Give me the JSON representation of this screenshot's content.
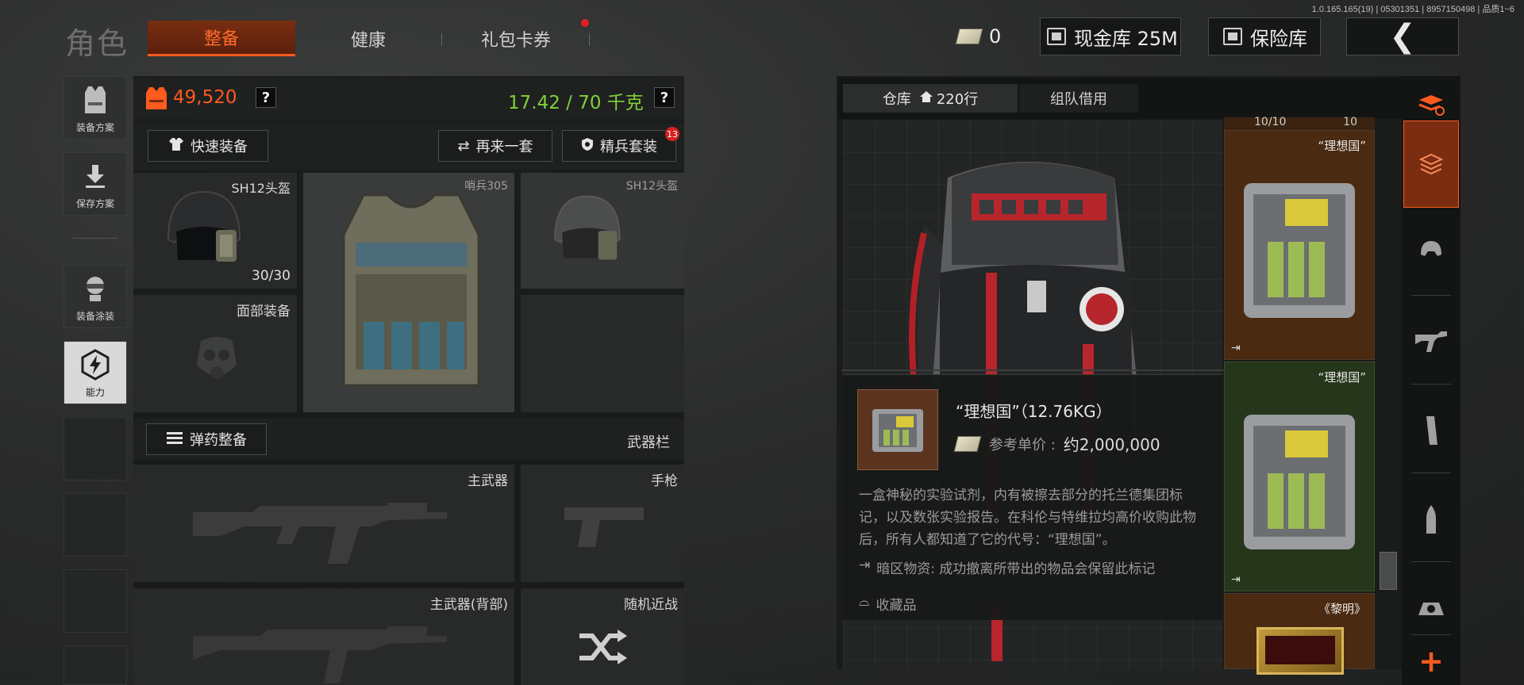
{
  "version": "1.0.165.165(19) | 05301351 | 8957150498 | 品质1~6",
  "nav": {
    "role": "角色",
    "tabs": [
      "整备",
      "健康",
      "礼包卡券"
    ],
    "cash_count": "0",
    "cash_vault": "现金库 25M",
    "insurance": "保险库",
    "back": "❮"
  },
  "left_rail": [
    {
      "label": "装备方案",
      "icon": "vest-icon"
    },
    {
      "label": "保存方案",
      "icon": "download-icon"
    },
    {
      "label": "装备涂装",
      "icon": "paint-icon"
    },
    {
      "label": "能力",
      "icon": "ability-icon"
    }
  ],
  "loadout": {
    "armor_value": "49,520",
    "weight": "17.42 / 70 千克",
    "help": "?",
    "quick_equip": "快速装备",
    "again": "再来一套",
    "elite": "精兵套装",
    "elite_badge": "13",
    "helmet_name": "SH12头盔",
    "helmet_durability": "30/30",
    "vest_name": "哨兵305",
    "helmet2_name": "SH12头盔",
    "face_gear": "面部装备",
    "ammo_equip": "弹药整备",
    "weapon_bar": "武器栏",
    "primary": "主武器",
    "pistol": "手枪",
    "primary_back": "主武器(背部)",
    "melee": "随机近战"
  },
  "warehouse": {
    "tab_main": "仓库",
    "rows": "220行",
    "tab_team": "组队借用",
    "top_left_count": "10/10",
    "top_right_count": "10"
  },
  "side_items": [
    {
      "title": "“理想国”",
      "color": "#4b2a12"
    },
    {
      "title": "“理想国”",
      "color": "#25361b"
    },
    {
      "title": "《黎明》",
      "color": "#4b2a12"
    }
  ],
  "tooltip": {
    "name": "“理想国”（12.76KG）",
    "price_label": "参考单价 :",
    "price_value": "约2,000,000",
    "description": "一盒神秘的实验试剂，内有被擦去部分的托兰德集团标记，以及数张实验报告。在科伦与特维拉均高价收购此物后，所有人都知道了它的代号：“理想国”。",
    "dark_zone": "暗区物资: 成功撤离所带出的物品会保留此标记",
    "collectible": "收藏品"
  },
  "right_rail": [
    "layers-icon",
    "stack-icon",
    "helmet-icon",
    "rifle-icon",
    "magazine-icon",
    "bullet-icon",
    "scope-icon",
    "add-icon"
  ]
}
